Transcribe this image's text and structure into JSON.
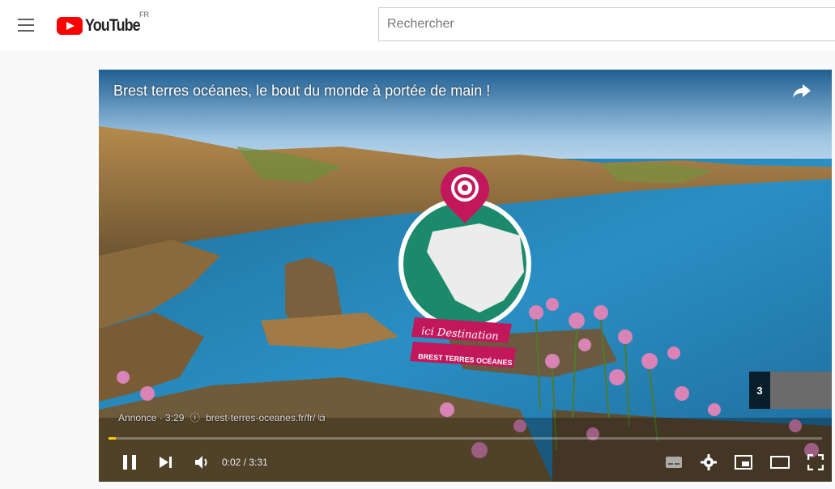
{
  "header": {
    "logo_text": "YouTube",
    "country_code": "FR",
    "search_placeholder": "Rechercher"
  },
  "player": {
    "title": "Brest terres océanes, le bout du monde à portée de main !",
    "ad_label": "Annonce · 3:29",
    "ad_url": "brest-terres-oceanes.fr/fr/",
    "time_display": "0:02 / 3:31",
    "endcard_number": "3",
    "progress_fraction": 0.01,
    "badge_line1": "ici Destination",
    "badge_line2": "BREST TERRES OCÉANES"
  },
  "colors": {
    "brand_red": "#ff0000",
    "progress": "#ffcc00",
    "badge_pink": "#c2185b",
    "globe_green": "#1b8a6b"
  }
}
